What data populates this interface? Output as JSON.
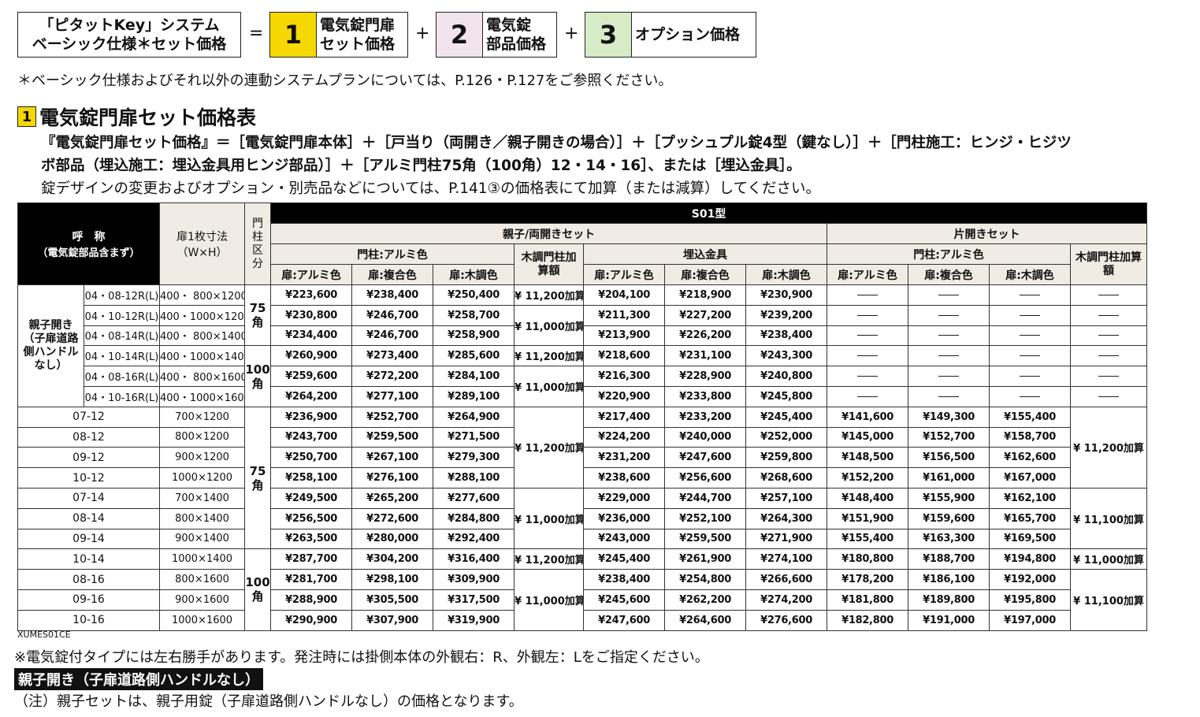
{
  "formula": {
    "system_label_1": "「ピタットKey」システム",
    "system_label_2": "ベーシック仕様＊セット価格",
    "equals": "=",
    "plus": "+",
    "item1": {
      "num": "1",
      "line1": "電気錠門扉",
      "line2": "セット価格",
      "color": "#f5d800"
    },
    "item2": {
      "num": "2",
      "line1": "電気錠",
      "line2": "部品価格",
      "color": "#f1e4ec"
    },
    "item3": {
      "num": "3",
      "line1": "オプション価格",
      "color": "#d6ebc6"
    }
  },
  "note_top": "＊ベーシック仕様およびそれ以外の連動システムプランについては、P.126・P.127をご参照ください。",
  "section": {
    "badge": "1",
    "title": "電気錠門扉セット価格表",
    "desc1": "『電気錠門扉セット価格』＝［電気錠門扉本体］＋［戸当り（両開き／親子開きの場合）］＋［プッシュプル錠4型（鍵なし）］＋［門柱施工：ヒンジ・ヒジツ",
    "desc2": "ボ部品（埋込施工：埋込金具用ヒンジ部品）］＋［アルミ門柱75角（100角）12・14・16］、または［埋込金具］。",
    "desc3": "錠デザインの変更およびオプション・別売品などについては、P.141③の価格表にて加算（または減算）してください。"
  },
  "table": {
    "h_name": "呼　称",
    "h_name_sub": "（電気錠部品含まず）",
    "h_dim": "扉1枚寸法",
    "h_dim_sub": "（W×H）",
    "h_post": "門柱区分",
    "h_type": "S01型",
    "h_set_double": "親子/両開きセット",
    "h_set_single": "片開きセット",
    "h_alu_post": "門柱:アルミ色",
    "h_wood_add": "木調門柱加算額",
    "h_embed": "埋込金具",
    "h_c1": "扉:アルミ色",
    "h_c2": "扉:複合色",
    "h_c3": "扉:木調色",
    "group_oyako": "親子開き（子扉道路側ハンドルなし）",
    "post_75": "75角",
    "post_100": "100角",
    "dash": "――",
    "rows": [
      {
        "name": "04・08-12R(L)",
        "dim": "400・ 800×1200",
        "a": [
          "¥223,600",
          "¥238,400",
          "¥250,400"
        ],
        "e": [
          "¥204,100",
          "¥218,900",
          "¥230,900"
        ],
        "s": [
          "",
          "",
          ""
        ]
      },
      {
        "name": "04・10-12R(L)",
        "dim": "400・1000×1200",
        "a": [
          "¥230,800",
          "¥246,700",
          "¥258,700"
        ],
        "e": [
          "¥211,300",
          "¥227,200",
          "¥239,200"
        ],
        "s": [
          "",
          "",
          ""
        ]
      },
      {
        "name": "04・08-14R(L)",
        "dim": "400・ 800×1400",
        "a": [
          "¥234,400",
          "¥246,700",
          "¥258,900"
        ],
        "e": [
          "¥213,900",
          "¥226,200",
          "¥238,400"
        ],
        "s": [
          "",
          "",
          ""
        ]
      },
      {
        "name": "04・10-14R(L)",
        "dim": "400・1000×1400",
        "a": [
          "¥260,900",
          "¥273,400",
          "¥285,600"
        ],
        "e": [
          "¥218,600",
          "¥231,100",
          "¥243,300"
        ],
        "s": [
          "",
          "",
          ""
        ]
      },
      {
        "name": "04・08-16R(L)",
        "dim": "400・ 800×1600",
        "a": [
          "¥259,600",
          "¥272,200",
          "¥284,100"
        ],
        "e": [
          "¥216,300",
          "¥228,900",
          "¥240,800"
        ],
        "s": [
          "",
          "",
          ""
        ]
      },
      {
        "name": "04・10-16R(L)",
        "dim": "400・1000×1600",
        "a": [
          "¥264,200",
          "¥277,100",
          "¥289,100"
        ],
        "e": [
          "¥220,900",
          "¥233,800",
          "¥245,800"
        ],
        "s": [
          "",
          "",
          ""
        ]
      },
      {
        "name": "07-12",
        "dim": "700×1200",
        "a": [
          "¥236,900",
          "¥252,700",
          "¥264,900"
        ],
        "e": [
          "¥217,400",
          "¥233,200",
          "¥245,400"
        ],
        "s": [
          "¥141,600",
          "¥149,300",
          "¥155,400"
        ]
      },
      {
        "name": "08-12",
        "dim": "800×1200",
        "a": [
          "¥243,700",
          "¥259,500",
          "¥271,500"
        ],
        "e": [
          "¥224,200",
          "¥240,000",
          "¥252,000"
        ],
        "s": [
          "¥145,000",
          "¥152,700",
          "¥158,700"
        ]
      },
      {
        "name": "09-12",
        "dim": "900×1200",
        "a": [
          "¥250,700",
          "¥267,100",
          "¥279,300"
        ],
        "e": [
          "¥231,200",
          "¥247,600",
          "¥259,800"
        ],
        "s": [
          "¥148,500",
          "¥156,500",
          "¥162,600"
        ]
      },
      {
        "name": "10-12",
        "dim": "1000×1200",
        "a": [
          "¥258,100",
          "¥276,100",
          "¥288,100"
        ],
        "e": [
          "¥238,600",
          "¥256,600",
          "¥268,600"
        ],
        "s": [
          "¥152,200",
          "¥161,000",
          "¥167,000"
        ]
      },
      {
        "name": "07-14",
        "dim": "700×1400",
        "a": [
          "¥249,500",
          "¥265,200",
          "¥277,600"
        ],
        "e": [
          "¥229,000",
          "¥244,700",
          "¥257,100"
        ],
        "s": [
          "¥148,400",
          "¥155,900",
          "¥162,100"
        ]
      },
      {
        "name": "08-14",
        "dim": "800×1400",
        "a": [
          "¥256,500",
          "¥272,600",
          "¥284,800"
        ],
        "e": [
          "¥236,000",
          "¥252,100",
          "¥264,300"
        ],
        "s": [
          "¥151,900",
          "¥159,600",
          "¥165,700"
        ]
      },
      {
        "name": "09-14",
        "dim": "900×1400",
        "a": [
          "¥263,500",
          "¥280,000",
          "¥292,400"
        ],
        "e": [
          "¥243,000",
          "¥259,500",
          "¥271,900"
        ],
        "s": [
          "¥155,400",
          "¥163,300",
          "¥169,500"
        ]
      },
      {
        "name": "10-14",
        "dim": "1000×1400",
        "a": [
          "¥287,700",
          "¥304,200",
          "¥316,400"
        ],
        "e": [
          "¥245,400",
          "¥261,900",
          "¥274,100"
        ],
        "s": [
          "¥180,800",
          "¥188,700",
          "¥194,800"
        ]
      },
      {
        "name": "08-16",
        "dim": "800×1600",
        "a": [
          "¥281,700",
          "¥298,100",
          "¥309,900"
        ],
        "e": [
          "¥238,400",
          "¥254,800",
          "¥266,600"
        ],
        "s": [
          "¥178,200",
          "¥186,100",
          "¥192,000"
        ]
      },
      {
        "name": "09-16",
        "dim": "900×1600",
        "a": [
          "¥288,900",
          "¥305,500",
          "¥317,500"
        ],
        "e": [
          "¥245,600",
          "¥262,200",
          "¥274,200"
        ],
        "s": [
          "¥181,800",
          "¥189,800",
          "¥195,800"
        ]
      },
      {
        "name": "10-16",
        "dim": "1000×1600",
        "a": [
          "¥290,900",
          "¥307,900",
          "¥319,900"
        ],
        "e": [
          "¥247,600",
          "¥264,600",
          "¥276,600"
        ],
        "s": [
          "¥182,800",
          "¥191,000",
          "¥197,000"
        ]
      }
    ],
    "adds_double": [
      {
        "start": 0,
        "span": 1,
        "text": "¥ 11,200加算"
      },
      {
        "start": 1,
        "span": 2,
        "text": "¥ 11,000加算"
      },
      {
        "start": 3,
        "span": 1,
        "text": "¥ 11,200加算"
      },
      {
        "start": 4,
        "span": 2,
        "text": "¥ 11,000加算"
      },
      {
        "start": 6,
        "span": 4,
        "text": "¥ 11,200加算"
      },
      {
        "start": 10,
        "span": 3,
        "text": "¥ 11,000加算"
      },
      {
        "start": 13,
        "span": 1,
        "text": "¥ 11,200加算"
      },
      {
        "start": 14,
        "span": 3,
        "text": "¥ 11,000加算"
      }
    ],
    "adds_single": [
      {
        "start": 6,
        "span": 4,
        "text": "¥ 11,200加算"
      },
      {
        "start": 10,
        "span": 3,
        "text": "¥ 11,100加算"
      },
      {
        "start": 13,
        "span": 1,
        "text": "¥ 11,000加算"
      },
      {
        "start": 14,
        "span": 3,
        "text": "¥ 11,100加算"
      }
    ],
    "code": "XUMES01CE"
  },
  "note_handed": "※電気錠付タイプには左右勝手があります。発注時には掛側本体の外観右：R、外観左：Lをご指定ください。",
  "tag": "親子開き（子扉道路側ハンドルなし）",
  "note_bottom": "（注）親子セットは、親子用錠（子扉道路側ハンドルなし）の価格となります。"
}
